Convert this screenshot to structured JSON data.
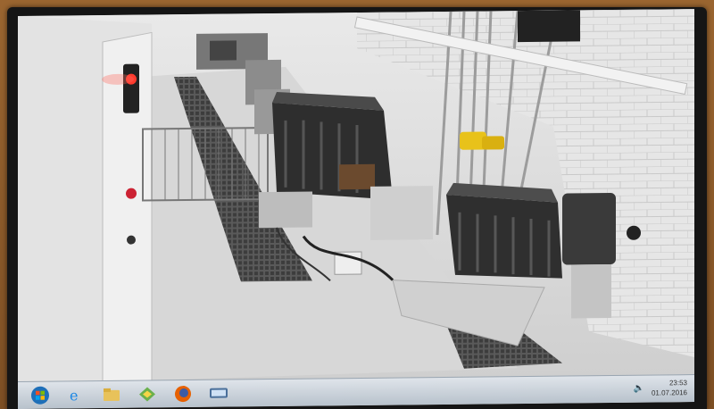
{
  "window": {
    "title": ""
  },
  "taskbar": {
    "items": [
      {
        "name": "start-orb-icon"
      },
      {
        "name": "internet-explorer-icon"
      },
      {
        "name": "file-explorer-icon"
      },
      {
        "name": "media-center-icon"
      },
      {
        "name": "firefox-icon"
      },
      {
        "name": "network-app-icon"
      }
    ],
    "tray": {
      "time": "23:53",
      "date": "01.07.2016",
      "volume_icon": "speaker-icon"
    }
  },
  "colors": {
    "bezel": "#151515",
    "floor": "#dcdcdc",
    "grating": "#4a4a4a",
    "magnet": "#2b2b2b",
    "hook": "#e8c21a",
    "alarm_light": "#ff3b2e"
  }
}
